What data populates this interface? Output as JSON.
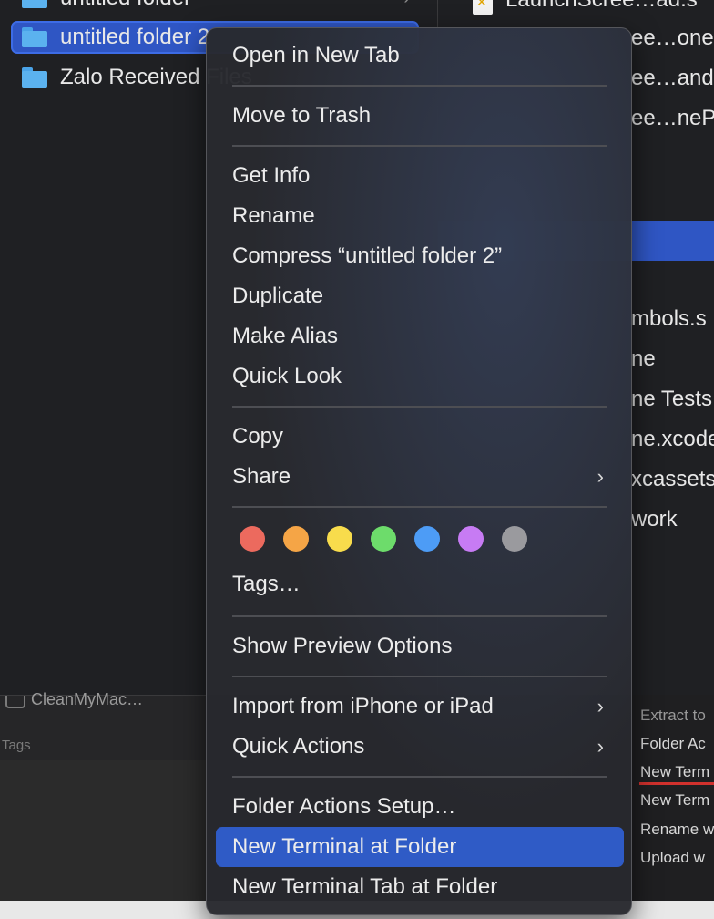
{
  "finder_left": {
    "rows": [
      {
        "name": "untitled folder"
      },
      {
        "name": "untitled folder 2"
      },
      {
        "name": "Zalo Received Files"
      }
    ]
  },
  "finder_right": {
    "rows": [
      "LaunchScree…ad.s",
      "ee…one.",
      "ee…ands",
      "ee…nePo",
      "",
      "",
      "mbols.s",
      "ne",
      "ne Tests",
      "ne.xcode",
      "xcassets",
      "work"
    ]
  },
  "sidebar": {
    "cleanmymac_label": "CleanMyMac…",
    "tags_label": "Tags"
  },
  "preview_actions": {
    "items": [
      "Extract to",
      "Folder Ac",
      "New Term",
      "New Term",
      "Rename w",
      "Upload w"
    ]
  },
  "context_menu": {
    "open_new_tab": "Open in New Tab",
    "move_to_trash": "Move to Trash",
    "get_info": "Get Info",
    "rename": "Rename",
    "compress": "Compress “untitled folder 2”",
    "duplicate": "Duplicate",
    "make_alias": "Make Alias",
    "quick_look": "Quick Look",
    "copy": "Copy",
    "share": "Share",
    "tags": "Tags…",
    "show_preview_options": "Show Preview Options",
    "import_from_iphone": "Import from iPhone or iPad",
    "quick_actions": "Quick Actions",
    "folder_actions_setup": "Folder Actions Setup…",
    "new_terminal_at_folder": "New Terminal at Folder",
    "new_terminal_tab_at_folder": "New Terminal Tab at Folder",
    "submenu_glyph": "›",
    "tag_colors": [
      "#ec6a5e",
      "#f5a546",
      "#f8dc4c",
      "#6ddc6b",
      "#4d9cf6",
      "#c77bf4",
      "#9a9a9e"
    ]
  }
}
